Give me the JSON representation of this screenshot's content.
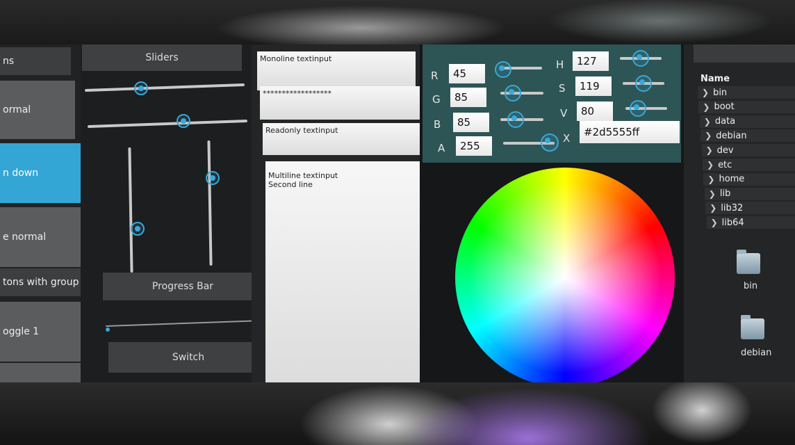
{
  "buttons": {
    "b1": "ns",
    "b2": "ormal",
    "b3": "n down",
    "b4": "e normal",
    "b5": "tons with group",
    "b6": "oggle 1"
  },
  "sliders": {
    "header": "Sliders",
    "progress_label": "Progress Bar",
    "switch_label": "Switch",
    "h1": 0.35,
    "h2": 0.6,
    "v1": 0.35,
    "v2": 0.7,
    "progress": 0.01
  },
  "inputs": {
    "monoline": "Monoline textinput",
    "password": "******************",
    "readonly": "Readonly textinput",
    "multiline_1": "Multiline textinput",
    "multiline_2": "Second line"
  },
  "colorpicker": {
    "labels": {
      "r": "R",
      "g": "G",
      "b": "B",
      "a": "A",
      "h": "H",
      "s": "S",
      "v": "V",
      "x": "X"
    },
    "r": "45",
    "g": "85",
    "b": "85",
    "a": "255",
    "h": "127",
    "s": "119",
    "v": "80",
    "hex": "#2d5555ff",
    "accent": "#2d5555"
  },
  "filechooser": {
    "column": "Name",
    "items": [
      "bin",
      "boot",
      "data",
      "debian",
      "dev",
      "etc",
      "home",
      "lib",
      "lib32",
      "lib64"
    ],
    "icons": [
      "bin",
      "debian"
    ]
  }
}
